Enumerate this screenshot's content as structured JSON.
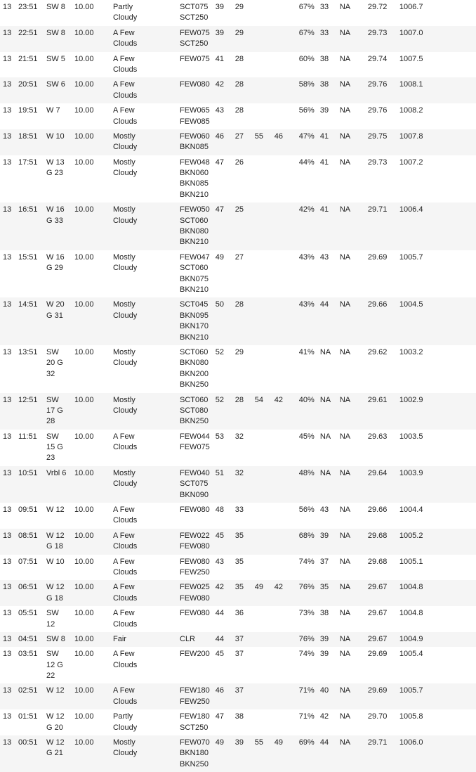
{
  "rows": [
    {
      "day": "13",
      "time": "23:51",
      "wind_dir": "SW 8",
      "visibility": "10.00",
      "sky": "Partly\nCloudy",
      "sky_codes": "SCT075\nSCT250",
      "temp": "39",
      "dew": "29",
      "c1": "",
      "c2": "",
      "humidity": "67%",
      "altimeter": "33",
      "extra1": "NA",
      "pressure1": "29.72",
      "pressure2": "1006.7",
      "e1": "",
      "e2": ""
    },
    {
      "day": "13",
      "time": "22:51",
      "wind_dir": "SW 8",
      "visibility": "10.00",
      "sky": "A Few\nClouds",
      "sky_codes": "FEW075\nSCT250",
      "temp": "39",
      "dew": "29",
      "c1": "",
      "c2": "",
      "humidity": "67%",
      "altimeter": "33",
      "extra1": "NA",
      "pressure1": "29.73",
      "pressure2": "1007.0",
      "e1": "",
      "e2": ""
    },
    {
      "day": "13",
      "time": "21:51",
      "wind_dir": "SW 5",
      "visibility": "10.00",
      "sky": "A Few\nClouds",
      "sky_codes": "FEW075",
      "temp": "41",
      "dew": "28",
      "c1": "",
      "c2": "",
      "humidity": "60%",
      "altimeter": "38",
      "extra1": "NA",
      "pressure1": "29.74",
      "pressure2": "1007.5",
      "e1": "",
      "e2": ""
    },
    {
      "day": "13",
      "time": "20:51",
      "wind_dir": "SW 6",
      "visibility": "10.00",
      "sky": "A Few\nClouds",
      "sky_codes": "FEW080",
      "temp": "42",
      "dew": "28",
      "c1": "",
      "c2": "",
      "humidity": "58%",
      "altimeter": "38",
      "extra1": "NA",
      "pressure1": "29.76",
      "pressure2": "1008.1",
      "e1": "",
      "e2": ""
    },
    {
      "day": "13",
      "time": "19:51",
      "wind_dir": "W 7",
      "visibility": "10.00",
      "sky": "A Few\nClouds",
      "sky_codes": "FEW065\nFEW085",
      "temp": "43",
      "dew": "28",
      "c1": "",
      "c2": "",
      "humidity": "56%",
      "altimeter": "39",
      "extra1": "NA",
      "pressure1": "29.76",
      "pressure2": "1008.2",
      "e1": "",
      "e2": ""
    },
    {
      "day": "13",
      "time": "18:51",
      "wind_dir": "W 10",
      "visibility": "10.00",
      "sky": "Mostly\nCloudy",
      "sky_codes": "FEW060\nBKN085",
      "temp": "46",
      "dew": "27",
      "c1": "55",
      "c2": "46",
      "humidity": "47%",
      "altimeter": "41",
      "extra1": "NA",
      "pressure1": "29.75",
      "pressure2": "1007.8",
      "e1": "",
      "e2": ""
    },
    {
      "day": "13",
      "time": "17:51",
      "wind_dir": "W 13\nG 23",
      "visibility": "10.00",
      "sky": "Mostly\nCloudy",
      "sky_codes": "FEW048\nBKN060\nBKN085\nBKN210",
      "temp": "47",
      "dew": "26",
      "c1": "",
      "c2": "",
      "humidity": "44%",
      "altimeter": "41",
      "extra1": "NA",
      "pressure1": "29.73",
      "pressure2": "1007.2",
      "e1": "",
      "e2": ""
    },
    {
      "day": "13",
      "time": "16:51",
      "wind_dir": "W 16\nG 33",
      "visibility": "10.00",
      "sky": "Mostly\nCloudy",
      "sky_codes": "FEW050\nSCT060\nBKN080\nBKN210",
      "temp": "47",
      "dew": "25",
      "c1": "",
      "c2": "",
      "humidity": "42%",
      "altimeter": "41",
      "extra1": "NA",
      "pressure1": "29.71",
      "pressure2": "1006.4",
      "e1": "",
      "e2": ""
    },
    {
      "day": "13",
      "time": "15:51",
      "wind_dir": "W 16\nG 29",
      "visibility": "10.00",
      "sky": "Mostly\nCloudy",
      "sky_codes": "FEW047\nSCT060\nBKN075\nBKN210",
      "temp": "49",
      "dew": "27",
      "c1": "",
      "c2": "",
      "humidity": "43%",
      "altimeter": "43",
      "extra1": "NA",
      "pressure1": "29.69",
      "pressure2": "1005.7",
      "e1": "",
      "e2": ""
    },
    {
      "day": "13",
      "time": "14:51",
      "wind_dir": "W 20\nG 31",
      "visibility": "10.00",
      "sky": "Mostly\nCloudy",
      "sky_codes": "SCT045\nBKN095\nBKN170\nBKN210",
      "temp": "50",
      "dew": "28",
      "c1": "",
      "c2": "",
      "humidity": "43%",
      "altimeter": "44",
      "extra1": "NA",
      "pressure1": "29.66",
      "pressure2": "1004.5",
      "e1": "",
      "e2": ""
    },
    {
      "day": "13",
      "time": "13:51",
      "wind_dir": "SW\n20 G\n32",
      "visibility": "10.00",
      "sky": "Mostly\nCloudy",
      "sky_codes": "SCT060\nBKN080\nBKN200\nBKN250",
      "temp": "52",
      "dew": "29",
      "c1": "",
      "c2": "",
      "humidity": "41%",
      "altimeter": "NA",
      "extra1": "NA",
      "pressure1": "29.62",
      "pressure2": "1003.2",
      "e1": "",
      "e2": ""
    },
    {
      "day": "13",
      "time": "12:51",
      "wind_dir": "SW\n17 G\n28",
      "visibility": "10.00",
      "sky": "Mostly\nCloudy",
      "sky_codes": "SCT060\nSCT080\nBKN250",
      "temp": "52",
      "dew": "28",
      "c1": "54",
      "c2": "42",
      "humidity": "40%",
      "altimeter": "NA",
      "extra1": "NA",
      "pressure1": "29.61",
      "pressure2": "1002.9",
      "e1": "",
      "e2": ""
    },
    {
      "day": "13",
      "time": "11:51",
      "wind_dir": "SW\n15 G\n23",
      "visibility": "10.00",
      "sky": "A Few\nClouds",
      "sky_codes": "FEW044\nFEW075",
      "temp": "53",
      "dew": "32",
      "c1": "",
      "c2": "",
      "humidity": "45%",
      "altimeter": "NA",
      "extra1": "NA",
      "pressure1": "29.63",
      "pressure2": "1003.5",
      "e1": "",
      "e2": ""
    },
    {
      "day": "13",
      "time": "10:51",
      "wind_dir": "Vrbl 6",
      "visibility": "10.00",
      "sky": "Mostly\nCloudy",
      "sky_codes": "FEW040\nSCT075\nBKN090",
      "temp": "51",
      "dew": "32",
      "c1": "",
      "c2": "",
      "humidity": "48%",
      "altimeter": "NA",
      "extra1": "NA",
      "pressure1": "29.64",
      "pressure2": "1003.9",
      "e1": "",
      "e2": ""
    },
    {
      "day": "13",
      "time": "09:51",
      "wind_dir": "W 12",
      "visibility": "10.00",
      "sky": "A Few\nClouds",
      "sky_codes": "FEW080",
      "temp": "48",
      "dew": "33",
      "c1": "",
      "c2": "",
      "humidity": "56%",
      "altimeter": "43",
      "extra1": "NA",
      "pressure1": "29.66",
      "pressure2": "1004.4",
      "e1": "",
      "e2": ""
    },
    {
      "day": "13",
      "time": "08:51",
      "wind_dir": "W 12\nG 18",
      "visibility": "10.00",
      "sky": "A Few\nClouds",
      "sky_codes": "FEW022\nFEW080",
      "temp": "45",
      "dew": "35",
      "c1": "",
      "c2": "",
      "humidity": "68%",
      "altimeter": "39",
      "extra1": "NA",
      "pressure1": "29.68",
      "pressure2": "1005.2",
      "e1": "",
      "e2": ""
    },
    {
      "day": "13",
      "time": "07:51",
      "wind_dir": "W 10",
      "visibility": "10.00",
      "sky": "A Few\nClouds",
      "sky_codes": "FEW080\nFEW250",
      "temp": "43",
      "dew": "35",
      "c1": "",
      "c2": "",
      "humidity": "74%",
      "altimeter": "37",
      "extra1": "NA",
      "pressure1": "29.68",
      "pressure2": "1005.1",
      "e1": "",
      "e2": ""
    },
    {
      "day": "13",
      "time": "06:51",
      "wind_dir": "W 12\nG 18",
      "visibility": "10.00",
      "sky": "A Few\nClouds",
      "sky_codes": "FEW025\nFEW080",
      "temp": "42",
      "dew": "35",
      "c1": "49",
      "c2": "42",
      "humidity": "76%",
      "altimeter": "35",
      "extra1": "NA",
      "pressure1": "29.67",
      "pressure2": "1004.8",
      "e1": "",
      "e2": ""
    },
    {
      "day": "13",
      "time": "05:51",
      "wind_dir": "SW\n12",
      "visibility": "10.00",
      "sky": "A Few\nClouds",
      "sky_codes": "FEW080",
      "temp": "44",
      "dew": "36",
      "c1": "",
      "c2": "",
      "humidity": "73%",
      "altimeter": "38",
      "extra1": "NA",
      "pressure1": "29.67",
      "pressure2": "1004.8",
      "e1": "",
      "e2": ""
    },
    {
      "day": "13",
      "time": "04:51",
      "wind_dir": "SW 8",
      "visibility": "10.00",
      "sky": "Fair",
      "sky_codes": "CLR",
      "temp": "44",
      "dew": "37",
      "c1": "",
      "c2": "",
      "humidity": "76%",
      "altimeter": "39",
      "extra1": "NA",
      "pressure1": "29.67",
      "pressure2": "1004.9",
      "e1": "",
      "e2": ""
    },
    {
      "day": "13",
      "time": "03:51",
      "wind_dir": "SW\n12 G\n22",
      "visibility": "10.00",
      "sky": "A Few\nClouds",
      "sky_codes": "FEW200",
      "temp": "45",
      "dew": "37",
      "c1": "",
      "c2": "",
      "humidity": "74%",
      "altimeter": "39",
      "extra1": "NA",
      "pressure1": "29.69",
      "pressure2": "1005.4",
      "e1": "",
      "e2": ""
    },
    {
      "day": "13",
      "time": "02:51",
      "wind_dir": "W 12",
      "visibility": "10.00",
      "sky": "A Few\nClouds",
      "sky_codes": "FEW180\nFEW250",
      "temp": "46",
      "dew": "37",
      "c1": "",
      "c2": "",
      "humidity": "71%",
      "altimeter": "40",
      "extra1": "NA",
      "pressure1": "29.69",
      "pressure2": "1005.7",
      "e1": "",
      "e2": ""
    },
    {
      "day": "13",
      "time": "01:51",
      "wind_dir": "W 12\nG 20",
      "visibility": "10.00",
      "sky": "Partly\nCloudy",
      "sky_codes": "FEW180\nSCT250",
      "temp": "47",
      "dew": "38",
      "c1": "",
      "c2": "",
      "humidity": "71%",
      "altimeter": "42",
      "extra1": "NA",
      "pressure1": "29.70",
      "pressure2": "1005.8",
      "e1": "",
      "e2": ""
    },
    {
      "day": "13",
      "time": "00:51",
      "wind_dir": "W 12\nG 21",
      "visibility": "10.00",
      "sky": "Mostly\nCloudy",
      "sky_codes": "FEW070\nBKN180\nBKN250",
      "temp": "49",
      "dew": "39",
      "c1": "55",
      "c2": "49",
      "humidity": "69%",
      "altimeter": "44",
      "extra1": "NA",
      "pressure1": "29.71",
      "pressure2": "1006.0",
      "e1": "",
      "e2": ""
    }
  ]
}
